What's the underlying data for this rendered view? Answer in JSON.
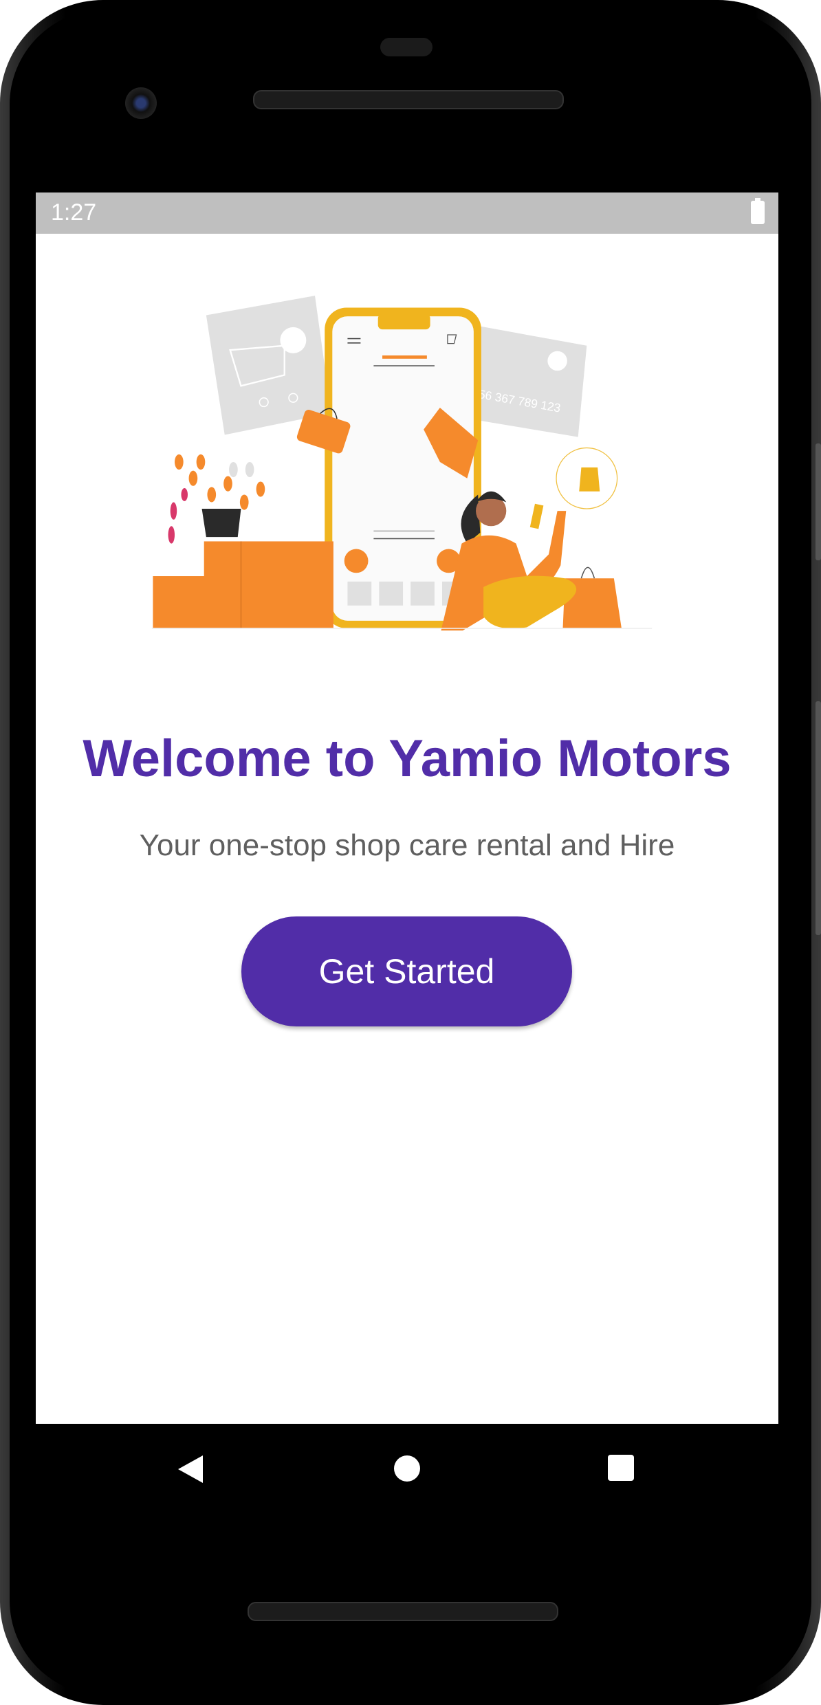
{
  "status_bar": {
    "time": "1:27",
    "battery_icon": "battery-full-icon"
  },
  "welcome": {
    "title": "Welcome to Yamio Motors",
    "subtitle": "Your one-stop shop care rental and Hire",
    "cta_label": "Get Started"
  },
  "illustration": {
    "card_number": "56 367 789 123"
  },
  "nav_bar": {
    "back_icon": "back-triangle-icon",
    "home_icon": "home-circle-icon",
    "recents_icon": "recents-square-icon"
  },
  "colors": {
    "primary": "#512da8",
    "accent_orange": "#f58a2c",
    "accent_yellow": "#f0b41e",
    "status_bar": "#bfbfbf"
  }
}
